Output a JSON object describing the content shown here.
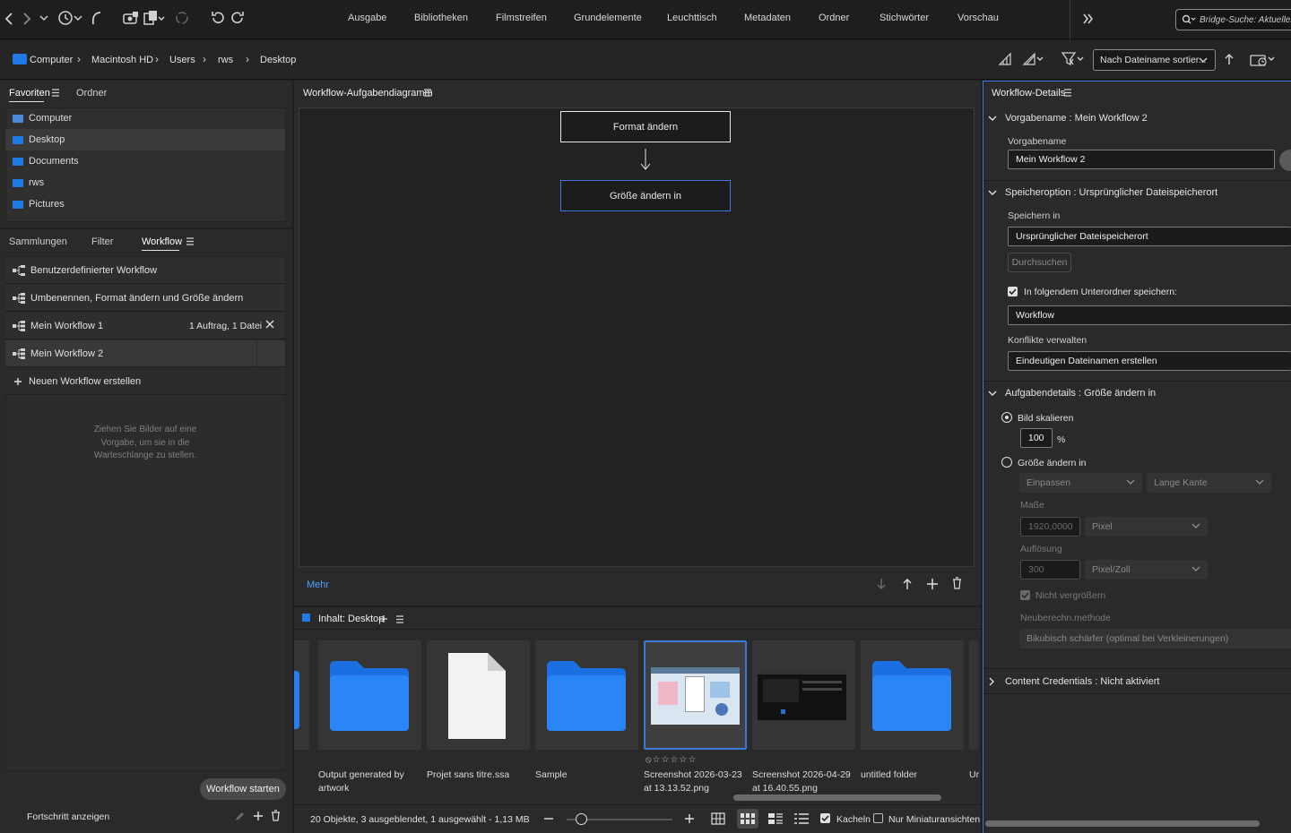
{
  "nav_tabs": [
    "Ausgabe",
    "Bibliotheken",
    "Filmstreifen",
    "Grundelemente",
    "Leuchttisch",
    "Metadaten",
    "Ordner",
    "Stichwörter",
    "Vorschau"
  ],
  "search": {
    "placeholder": "Bridge-Suche: Aktueller"
  },
  "breadcrumb": [
    "Computer",
    "Macintosh HD",
    "Users",
    "rws",
    "Desktop"
  ],
  "sort": {
    "label": "Nach Dateiname sortier..."
  },
  "favorites_panel": {
    "tabs": [
      "Favoriten",
      "Ordner"
    ],
    "items": [
      "Computer",
      "Desktop",
      "Documents",
      "rws",
      "Pictures"
    ]
  },
  "workflow_panel": {
    "tabs": [
      "Sammlungen",
      "Filter",
      "Workflow"
    ],
    "items": [
      {
        "label": "Benutzerdefinierter Workflow",
        "meta": ""
      },
      {
        "label": "Umbenennen, Format ändern und Größe ändern",
        "meta": ""
      },
      {
        "label": "Mein Workflow 1",
        "meta": "1 Auftrag, 1 Datei"
      },
      {
        "label": "Mein Workflow 2",
        "meta": ""
      }
    ],
    "new_label": "Neuen Workflow erstellen",
    "hint": "Ziehen Sie Bilder auf eine Vorgabe, um sie in die Warteschlange zu stellen.",
    "start_button": "Workflow starten",
    "progress_label": "Fortschritt anzeigen"
  },
  "diagram_panel": {
    "title": "Workflow-Aufgabendiagramm",
    "boxes": [
      "Format ändern",
      "Größe ändern in"
    ],
    "more_link": "Mehr"
  },
  "content_panel": {
    "title": "Inhalt: Desktop",
    "items": [
      {
        "name": "Output generated by artwork",
        "kind": "folder"
      },
      {
        "name": "Projet sans titre.ssa",
        "kind": "file"
      },
      {
        "name": "Sample",
        "kind": "folder"
      },
      {
        "name": "Screenshot 2026-03-23 at 13.13.52.png",
        "kind": "image"
      },
      {
        "name": "Screenshot 2026-04-29 at 16.40.55.png",
        "kind": "image-dark"
      },
      {
        "name": "untitled folder",
        "kind": "folder"
      },
      {
        "name": "Ur",
        "kind": "folder"
      }
    ],
    "status": "20 Objekte, 3 ausgeblendet, 1 ausgewählt - 1,13 MB",
    "tiles_label": "Kacheln",
    "thumbs_only_label": "Nur Miniaturansichten"
  },
  "details_panel": {
    "title": "Workflow-Details",
    "preset": {
      "header": "Vorgabename : Mein Workflow 2",
      "label": "Vorgabename",
      "value": "Mein Workflow 2"
    },
    "save": {
      "header": "Speicheroption : Ursprünglicher Dateispeicherort",
      "save_in_label": "Speichern in",
      "save_in_value": "Ursprünglicher Dateispeicherort",
      "browse_button": "Durchsuchen",
      "subfolder_label": "In folgendem Unterordner speichern:",
      "subfolder_value": "Workflow",
      "conflicts_label": "Konflikte verwalten",
      "conflicts_value": "Eindeutigen Dateinamen erstellen"
    },
    "task": {
      "header": "Aufgabendetails : Größe ändern in",
      "scale_label": "Bild skalieren",
      "scale_value": "100",
      "scale_unit": "%",
      "resize_label": "Größe ändern in",
      "fit_value": "Einpassen",
      "edge_value": "Lange Kante",
      "dims_label": "Maße",
      "dims_value": "1920,0000",
      "dims_unit": "Pixel",
      "res_label": "Auflösung",
      "res_value": "300",
      "res_unit": "Pixel/Zoll",
      "no_enlarge_label": "Nicht vergrößern",
      "resample_label": "Neuberechn.methode",
      "resample_value": "Bikubisch schärfer (optimal bei Verkleinerungen)"
    },
    "credentials": {
      "header": "Content Credentials : Nicht aktiviert"
    }
  },
  "colors": {
    "accent": "#1f7ae6",
    "selection_border": "#3b79d9",
    "link": "#4ea1ff"
  }
}
